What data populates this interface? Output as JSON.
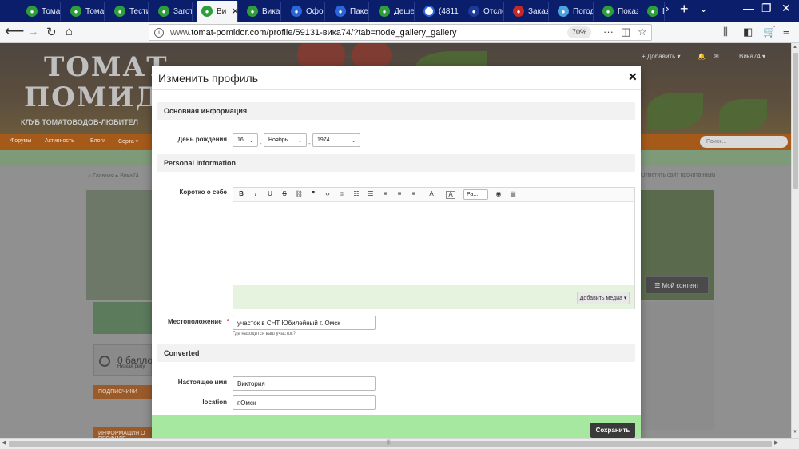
{
  "browser": {
    "tabs": [
      {
        "label": "Томат",
        "icon": "green"
      },
      {
        "label": "Томат",
        "icon": "green"
      },
      {
        "label": "Тести",
        "icon": "green"
      },
      {
        "label": "Загот",
        "icon": "green"
      },
      {
        "label": "Ви",
        "icon": "green",
        "active": true
      },
      {
        "label": "Вика7",
        "icon": "green"
      },
      {
        "label": "Офор",
        "icon": "blue"
      },
      {
        "label": "Пакет",
        "icon": "blue"
      },
      {
        "label": "Деше",
        "icon": "green"
      },
      {
        "label": "(4811)",
        "icon": "ring"
      },
      {
        "label": "Отсле",
        "icon": "navy"
      },
      {
        "label": "Заказ",
        "icon": "red"
      },
      {
        "label": "Погод",
        "icon": "sky"
      },
      {
        "label": "Показ",
        "icon": "green"
      },
      {
        "label": "D",
        "icon": "green"
      }
    ],
    "url_prefix": "www.",
    "url": "tomat-pomidor.com/profile/59131-вика74/?tab=node_gallery_gallery",
    "zoom": "70%"
  },
  "background_page": {
    "logo_line1": "ТОМАТ",
    "logo_line2": "ПОМИДОР",
    "tagline": "КЛУБ ТОМАТОВОДОВ-ЛЮБИТЕЛ",
    "add_link": "+ Добавить ▾",
    "user_name": "Вика74 ▾",
    "menu": [
      "Форумы",
      "Активность",
      "Блоги",
      "Сорта ▾"
    ],
    "search_placeholder": "Поиск...",
    "breadcrumb": "⌂ Главная ▸ Вика74",
    "right_note": "Отметить сайт прочитанным",
    "my_content": "Мой контент",
    "points": "0 баллов",
    "points_sub": "Низкая репу",
    "side_header1": "ПОДПИСЧИКИ",
    "side_header2": "ИНФОРМАЦИЯ О ПРОФИЛЕ"
  },
  "modal": {
    "title": "Изменить профиль",
    "close": "✕",
    "section_basic": "Основная информация",
    "birthday_label": "День рождения",
    "birthday_day": "16",
    "birthday_month": "Ноябрь",
    "birthday_year": "1974",
    "section_personal": "Personal Information",
    "about_label": "Коротко о себе",
    "editor_format": "Ра...",
    "add_media": "Добавить медиа ▾",
    "location_label": "Местоположение",
    "location_required": "*",
    "location_value": "участок в СНТ Юбилейный г. Омск",
    "location_hint": "Где находится ваш участок?",
    "section_converted": "Converted",
    "real_name_label": "Настоящее имя",
    "real_name_value": "Виктория",
    "location2_label": "location",
    "location2_value": "г.Омск",
    "save": "Сохранить"
  },
  "colors": {
    "tabbar": "#0b1e6b",
    "modal_footer": "#a7e8a0",
    "save_button": "#3a3a3a",
    "editor_footer": "#e6f4df"
  }
}
